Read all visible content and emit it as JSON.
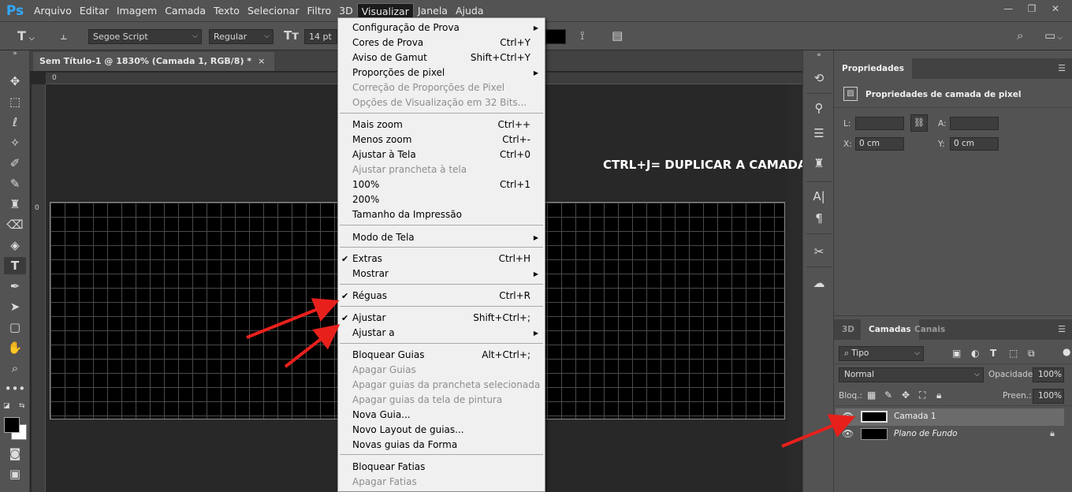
{
  "app": {
    "logo": "Ps",
    "menu": [
      "Arquivo",
      "Editar",
      "Imagem",
      "Camada",
      "Texto",
      "Selecionar",
      "Filtro",
      "3D",
      "Visualizar",
      "Janela",
      "Ajuda"
    ],
    "active_menu": "Visualizar",
    "window_controls": [
      "—",
      "❐",
      "✕"
    ]
  },
  "options_bar": {
    "font_family": "Segoe Script",
    "font_style": "Regular",
    "font_size": "14 pt"
  },
  "document": {
    "tab_title": "Sem Título-1 @ 1830% (Camada 1, RGB/8) *",
    "tab_close": "×",
    "ruler_top_zero": "0",
    "ruler_left_zero": "0"
  },
  "view_menu": {
    "items": [
      {
        "label": "Configuração de Prova",
        "shortcut": "",
        "submenu": true,
        "disabled": false,
        "checked": false
      },
      {
        "label": "Cores de Prova",
        "shortcut": "Ctrl+Y",
        "submenu": false,
        "disabled": false,
        "checked": false
      },
      {
        "label": "Aviso de Gamut",
        "shortcut": "Shift+Ctrl+Y",
        "submenu": false,
        "disabled": false,
        "checked": false
      },
      {
        "label": "Proporções de pixel",
        "shortcut": "",
        "submenu": true,
        "disabled": false,
        "checked": false
      },
      {
        "label": "Correção de Proporções de Pixel",
        "shortcut": "",
        "submenu": false,
        "disabled": true,
        "checked": false
      },
      {
        "label": "Opções de Visualização em 32 Bits...",
        "shortcut": "",
        "submenu": false,
        "disabled": true,
        "checked": false
      },
      {
        "label": "Mais zoom",
        "shortcut": "Ctrl++",
        "submenu": false,
        "disabled": false,
        "checked": false
      },
      {
        "label": "Menos zoom",
        "shortcut": "Ctrl+-",
        "submenu": false,
        "disabled": false,
        "checked": false
      },
      {
        "label": "Ajustar à Tela",
        "shortcut": "Ctrl+0",
        "submenu": false,
        "disabled": false,
        "checked": false
      },
      {
        "label": "Ajustar prancheta à tela",
        "shortcut": "",
        "submenu": false,
        "disabled": true,
        "checked": false
      },
      {
        "label": "100%",
        "shortcut": "Ctrl+1",
        "submenu": false,
        "disabled": false,
        "checked": false
      },
      {
        "label": "200%",
        "shortcut": "",
        "submenu": false,
        "disabled": false,
        "checked": false
      },
      {
        "label": "Tamanho da Impressão",
        "shortcut": "",
        "submenu": false,
        "disabled": false,
        "checked": false
      },
      {
        "label": "Modo de Tela",
        "shortcut": "",
        "submenu": true,
        "disabled": false,
        "checked": false
      },
      {
        "label": "Extras",
        "shortcut": "Ctrl+H",
        "submenu": false,
        "disabled": false,
        "checked": true
      },
      {
        "label": "Mostrar",
        "shortcut": "",
        "submenu": true,
        "disabled": false,
        "checked": false
      },
      {
        "label": "Réguas",
        "shortcut": "Ctrl+R",
        "submenu": false,
        "disabled": false,
        "checked": true
      },
      {
        "label": "Ajustar",
        "shortcut": "Shift+Ctrl+;",
        "submenu": false,
        "disabled": false,
        "checked": true
      },
      {
        "label": "Ajustar a",
        "shortcut": "",
        "submenu": true,
        "disabled": false,
        "checked": false
      },
      {
        "label": "Bloquear Guias",
        "shortcut": "Alt+Ctrl+;",
        "submenu": false,
        "disabled": false,
        "checked": false
      },
      {
        "label": "Apagar Guias",
        "shortcut": "",
        "submenu": false,
        "disabled": true,
        "checked": false
      },
      {
        "label": "Apagar guias da prancheta selecionada",
        "shortcut": "",
        "submenu": false,
        "disabled": true,
        "checked": false
      },
      {
        "label": "Apagar guias da tela de pintura",
        "shortcut": "",
        "submenu": false,
        "disabled": true,
        "checked": false
      },
      {
        "label": "Nova Guia...",
        "shortcut": "",
        "submenu": false,
        "disabled": false,
        "checked": false
      },
      {
        "label": "Novo Layout de guias...",
        "shortcut": "",
        "submenu": false,
        "disabled": false,
        "checked": false
      },
      {
        "label": "Novas guias da Forma",
        "shortcut": "",
        "submenu": false,
        "disabled": false,
        "checked": false
      },
      {
        "label": "Bloquear Fatias",
        "shortcut": "",
        "submenu": false,
        "disabled": false,
        "checked": false
      },
      {
        "label": "Apagar Fatias",
        "shortcut": "",
        "submenu": false,
        "disabled": true,
        "checked": false
      }
    ]
  },
  "annotation": "CTRL+J= DUPLICAR A CAMADA",
  "properties": {
    "tab": "Propriedades",
    "subtitle": "Propriedades de camada de pixel",
    "w_label": "L:",
    "w_value": "",
    "h_label": "A:",
    "h_value": "",
    "x_label": "X:",
    "x_value": "0 cm",
    "y_label": "Y:",
    "y_value": "0 cm"
  },
  "layers": {
    "tabs": [
      "3D",
      "Camadas",
      "Canais"
    ],
    "active_tab": "Camadas",
    "filter_label": "Tipo",
    "blend_mode": "Normal",
    "opacity_label": "Opacidade:",
    "opacity_value": "100%",
    "lock_label": "Bloq.:",
    "fill_label": "Preen.:",
    "fill_value": "100%",
    "items": [
      {
        "name": "Camada 1",
        "selected": true,
        "italic": false,
        "locked": false
      },
      {
        "name": "Plano de Fundo",
        "selected": false,
        "italic": true,
        "locked": true
      }
    ]
  },
  "colors": {
    "annotation_arrow": "#e8201c",
    "menu_bg": "#f0f0f0",
    "ui_gray": "#535353"
  }
}
